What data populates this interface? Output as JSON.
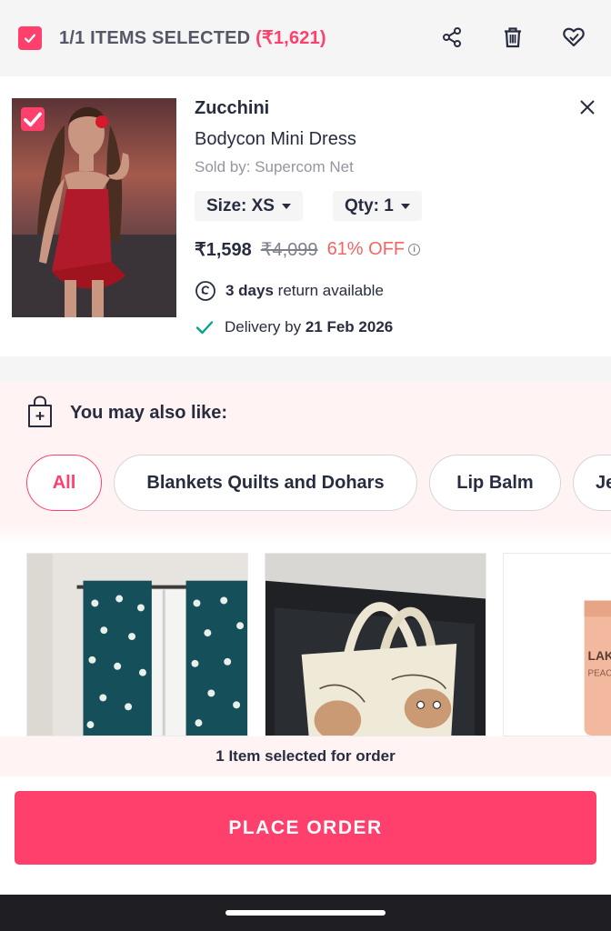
{
  "header": {
    "items_selected_label": "1/1 ITEMS SELECTED",
    "items_selected_amount": "(₹1,621)",
    "icons": [
      "share-icon",
      "delete-icon",
      "wishlist-icon"
    ]
  },
  "cart_item": {
    "brand": "Zucchini",
    "name": "Bodycon Mini Dress",
    "seller": "Sold by: Supercom Net",
    "size_label": "Size: XS",
    "qty_label": "Qty: 1",
    "price": "₹1,598",
    "mrp": "₹4,099",
    "discount": "61% OFF",
    "info_glyph": "i",
    "return_days": "3 days",
    "return_text": "return available",
    "delivery_prefix": "Delivery by",
    "delivery_date": "21 Feb 2026"
  },
  "suggestions": {
    "title": "You may also like:",
    "chips": [
      "All",
      "Blankets Quilts and Dohars",
      "Lip Balm",
      "Je"
    ],
    "active_chip": "All"
  },
  "footer": {
    "selected_text": "1 Item selected for order",
    "place_order_label": "PLACE ORDER"
  },
  "colors": {
    "accent": "#ff3f6c",
    "discount": "#f16565",
    "delivery_check": "#03a685"
  }
}
